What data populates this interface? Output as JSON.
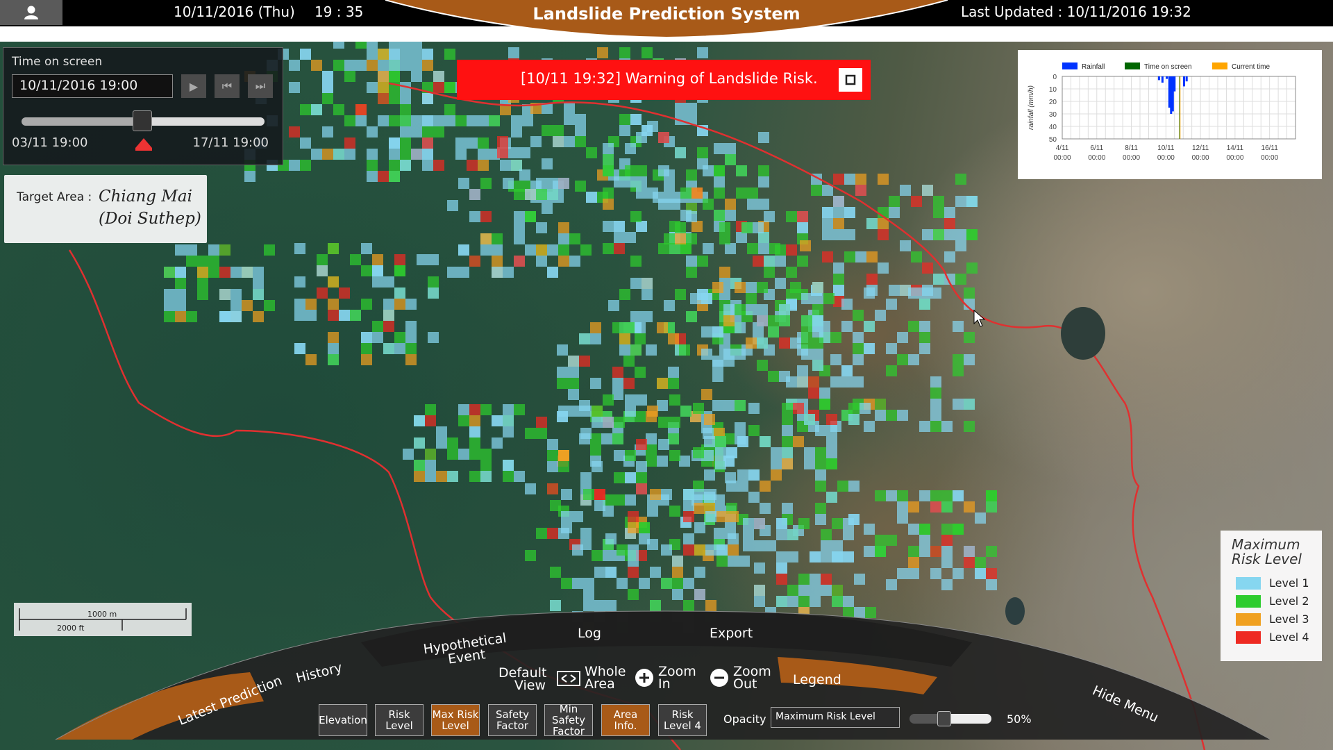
{
  "header": {
    "date": "10/11/2016 (Thu)",
    "clock": "19 : 35",
    "title": "Landslide Prediction System",
    "last_updated": "Last Updated : 10/11/2016 19:32"
  },
  "time_panel": {
    "label": "Time on screen",
    "value": "10/11/2016 19:00",
    "range_start": "03/11 19:00",
    "range_end": "17/11 19:00",
    "slider_position": 0.5
  },
  "target_area": {
    "label": "Target Area :",
    "name": "Chiang Mai",
    "sub": "(Doi Suthep)"
  },
  "warning": {
    "text": "[10/11 19:32] Warning of Landslide Risk.",
    "color": "#ff1a1a"
  },
  "chart_data": {
    "type": "bar",
    "ylabel": "rainfall (mm/h)",
    "y_ticks": [
      "0",
      "10",
      "20",
      "30",
      "40",
      "50"
    ],
    "ylim": [
      0,
      50
    ],
    "inverted_y": true,
    "x_ticks": [
      "4/11\n00:00",
      "6/11\n00:00",
      "8/11\n00:00",
      "10/11\n00:00",
      "12/11\n00:00",
      "14/11\n00:00",
      "16/11\n00:00"
    ],
    "x_domain": [
      0,
      13.5
    ],
    "grid": true,
    "legend": [
      "Rainfall",
      "Time on screen",
      "Current time"
    ],
    "legend_colors": [
      "#0033ff",
      "#006600",
      "#ffa500"
    ],
    "series": [
      {
        "name": "Rainfall",
        "x": [
          5.6,
          5.8,
          6.05,
          6.2,
          6.3,
          6.4,
          6.5,
          7.05,
          7.2
        ],
        "values": [
          3,
          5,
          2,
          25,
          30,
          28,
          12,
          8,
          4
        ]
      }
    ],
    "markers": {
      "time_on_screen": 6.8,
      "current_time": 6.82
    }
  },
  "legend": {
    "title_line1": "Maximum",
    "title_line2": "Risk Level",
    "items": [
      {
        "label": "Level 1",
        "color": "#86d6f0"
      },
      {
        "label": "Level 2",
        "color": "#2ecc2e"
      },
      {
        "label": "Level 3",
        "color": "#f0a020"
      },
      {
        "label": "Level 4",
        "color": "#ee2a22"
      }
    ]
  },
  "scale": {
    "metric": "1000 m",
    "imperial": "2000 ft"
  },
  "menu": {
    "tabs": [
      "Latest Prediction",
      "History",
      "Hypothetical Event",
      "Log",
      "Export",
      "Hide Menu"
    ],
    "view": {
      "default": "Default View",
      "whole": "Whole Area",
      "zoom_in": "Zoom In",
      "zoom_out": "Zoom Out",
      "legend": "Legend"
    },
    "tools": [
      "Elevation",
      "Risk Level",
      "Max Risk Level",
      "Safety Factor",
      "Min Safety Factor",
      "Area Info.",
      "Risk Level 4"
    ],
    "tools_active": [
      false,
      false,
      true,
      false,
      false,
      true,
      false
    ],
    "opacity_label": "Opacity",
    "opacity_select": "Maximum Risk Level",
    "opacity_value": "50%"
  },
  "colors": {
    "accent": "#a85a18",
    "boundary": "#e03030"
  }
}
